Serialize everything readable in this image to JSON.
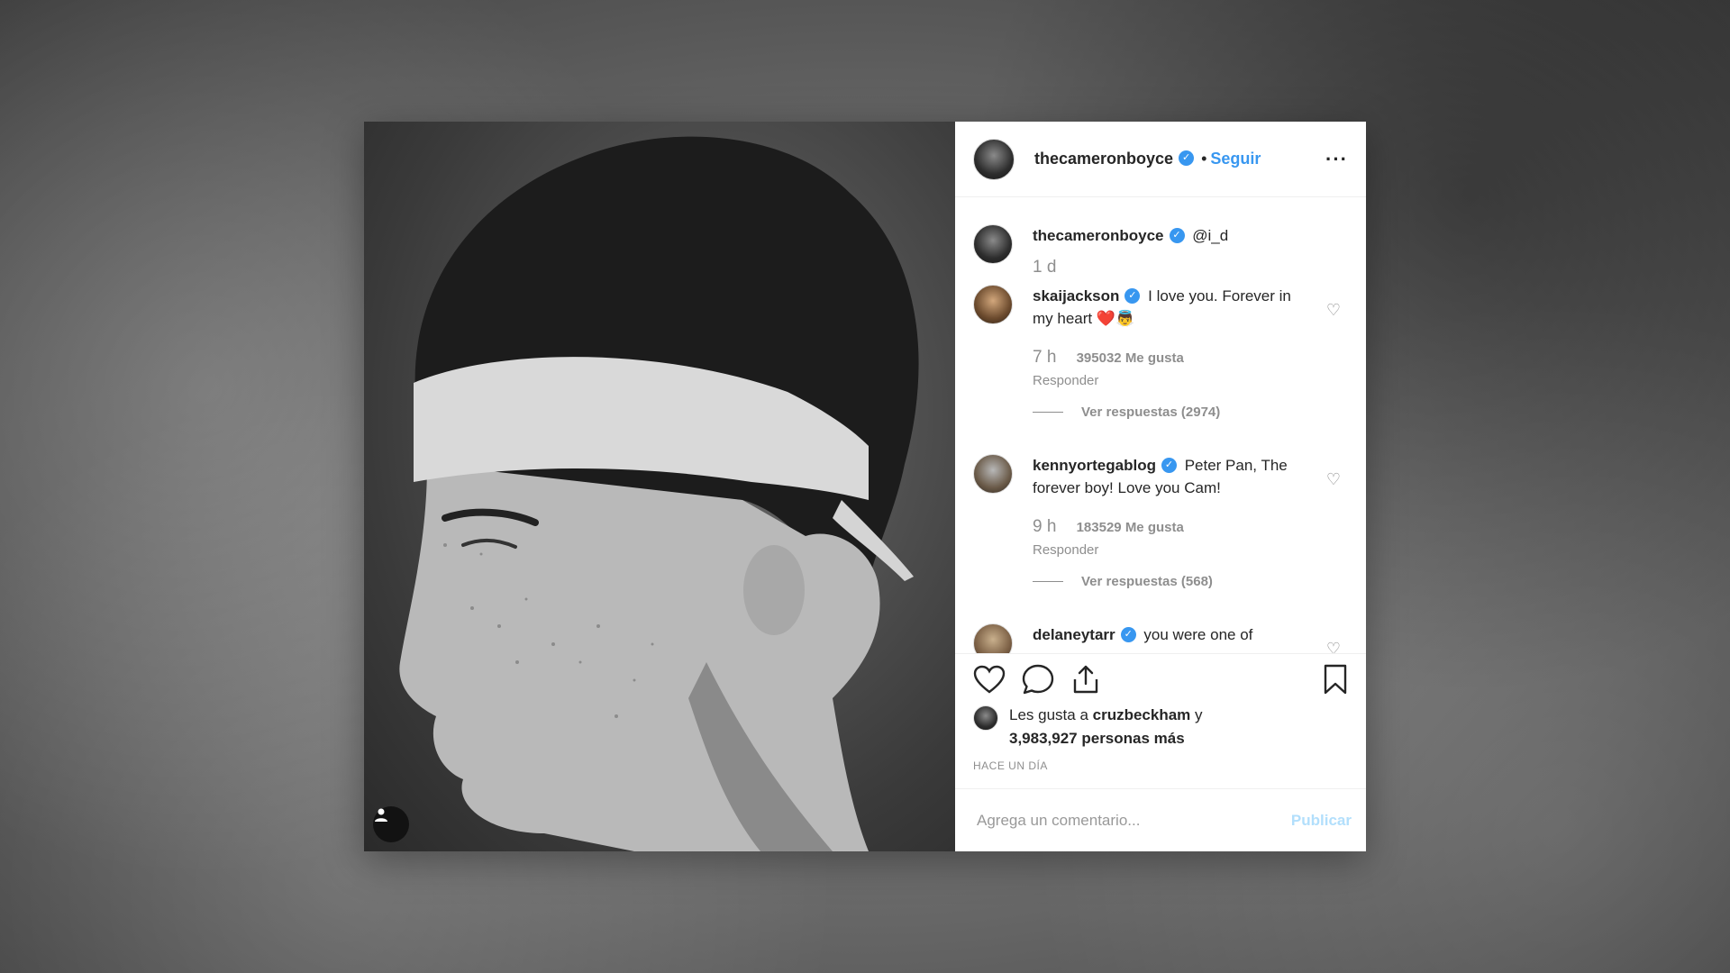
{
  "post": {
    "author": "thecameronboyce",
    "separator": "•",
    "follow_label": "Seguir",
    "more_label": "···",
    "caption": {
      "username": "thecameronboyce",
      "text": "@i_d",
      "time": "1 d"
    },
    "comments": [
      {
        "username": "skaijackson",
        "text": "I love you. Forever in my heart ❤️👼",
        "time": "7 h",
        "likes": "395032 Me gusta",
        "reply_label": "Responder",
        "view_replies": "Ver respuestas (2974)"
      },
      {
        "username": "kennyortegablog",
        "text": "Peter Pan, The forever boy! Love you Cam!",
        "time": "9 h",
        "likes": "183529 Me gusta",
        "reply_label": "Responder",
        "view_replies": "Ver respuestas (568)"
      },
      {
        "username": "delaneytarr",
        "text": "you were one of"
      }
    ],
    "likes": {
      "prefix": "Les gusta a",
      "user": "cruzbeckham",
      "conjunction": "y",
      "others": "3,983,927 personas más"
    },
    "posted_ago": "HACE UN DÍA",
    "comment_placeholder": "Agrega un comentario...",
    "publish_label": "Publicar",
    "colors": {
      "link": "#3897f0",
      "publish_disabled": "#b2dffc",
      "secondary_text": "#8e8e8e"
    },
    "icons": [
      "heart-icon",
      "comment-icon",
      "share-icon",
      "bookmark-icon",
      "user-tag-icon",
      "verified-icon"
    ]
  }
}
